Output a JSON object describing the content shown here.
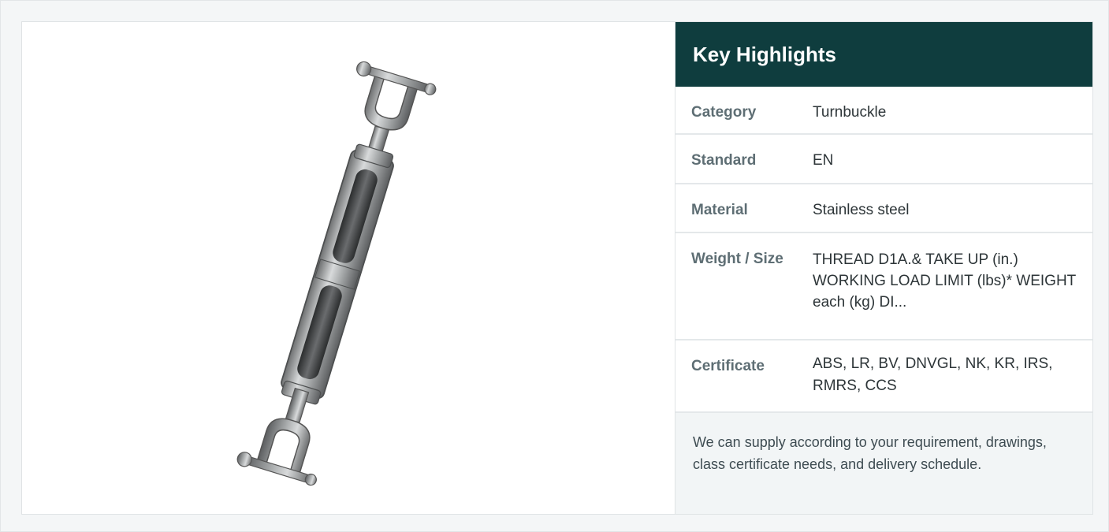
{
  "product": {
    "image_icon": "turnbuckle-image",
    "highlights_title": "Key Highlights",
    "specs": [
      {
        "label": "Category",
        "value": "Turnbuckle"
      },
      {
        "label": "Standard",
        "value": "EN"
      },
      {
        "label": "Material",
        "value": "Stainless steel"
      },
      {
        "label": "Weight / Size",
        "value": "THREAD D1A.& TAKE UP (in.) WORKING LOAD LIMIT (lbs)* WEIGHT each (kg) DI..."
      },
      {
        "label": "Certificate",
        "value": "ABS, LR, BV, DNVGL, NK, KR, IRS, RMRS, CCS"
      }
    ],
    "note": "We can supply according to your requirement, drawings, class certificate needs, and delivery schedule."
  },
  "colors": {
    "header_bg": "#0f3d3e",
    "note_bg": "#f2f5f6"
  }
}
